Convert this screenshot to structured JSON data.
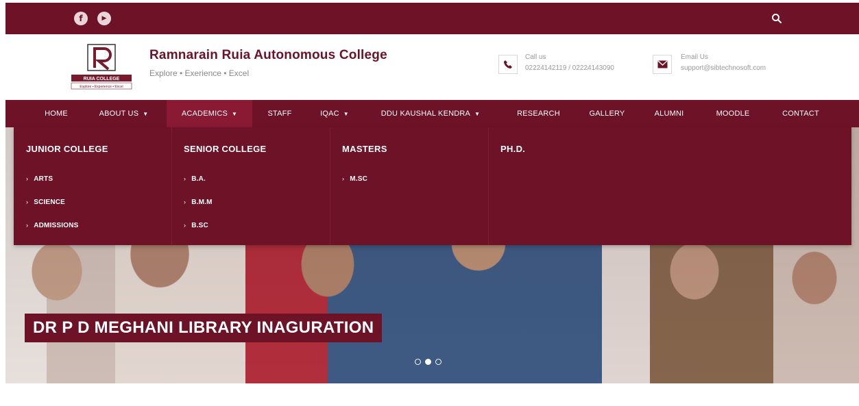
{
  "topbar": {
    "social": [
      {
        "name": "facebook-icon",
        "glyph": "f"
      },
      {
        "name": "youtube-icon",
        "glyph": "▶"
      }
    ]
  },
  "header": {
    "logo_text": "RUIA COLLEGE",
    "logo_subtext": "Explore • Experience • Excel",
    "college_name": "Ramnarain Ruia Autonomous College",
    "tagline": "Explore • Exerience • Excel",
    "call": {
      "label": "Call us",
      "value": "02224142119 / 02224143090"
    },
    "email": {
      "label": "Email Us",
      "value": "support@sibtechnosoft.com"
    }
  },
  "nav": {
    "items": [
      {
        "label": "HOME",
        "has_dropdown": false
      },
      {
        "label": "ABOUT US",
        "has_dropdown": true
      },
      {
        "label": "ACADEMICS",
        "has_dropdown": true,
        "active": true
      },
      {
        "label": "STAFF",
        "has_dropdown": false
      },
      {
        "label": "IQAC",
        "has_dropdown": true
      },
      {
        "label": "DDU KAUSHAL KENDRA",
        "has_dropdown": true
      },
      {
        "label": "RESEARCH",
        "has_dropdown": false
      },
      {
        "label": "GALLERY",
        "has_dropdown": false
      },
      {
        "label": "ALUMNI",
        "has_dropdown": false
      },
      {
        "label": "MOODLE",
        "has_dropdown": false
      },
      {
        "label": "CONTACT",
        "has_dropdown": false
      }
    ],
    "caret": "▼"
  },
  "mega_menu": {
    "columns": [
      {
        "heading": "JUNIOR COLLEGE",
        "links": [
          "ARTS",
          "SCIENCE",
          "ADMISSIONS"
        ]
      },
      {
        "heading": "SENIOR COLLEGE",
        "links": [
          "B.A.",
          "B.M.M",
          "B.SC"
        ]
      },
      {
        "heading": "MASTERS",
        "links": [
          "M.SC"
        ]
      },
      {
        "heading": "PH.D.",
        "links": []
      }
    ]
  },
  "hero": {
    "caption": "DR P D MEGHANI LIBRARY INAGURATION",
    "slides_total": 3,
    "active_slide": 2
  },
  "colors": {
    "brand": "#6e1228",
    "brand_active": "#8a1a34",
    "text_light": "#ffffff",
    "muted": "#9a9a9a"
  }
}
